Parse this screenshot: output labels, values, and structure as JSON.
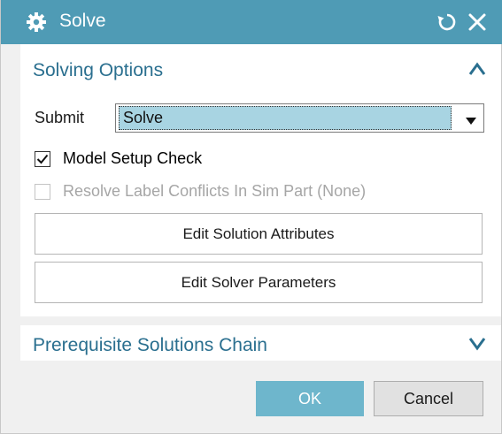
{
  "window": {
    "title": "Solve",
    "icons": {
      "app": "gear-icon",
      "reset": "reset-icon",
      "close": "close-icon"
    },
    "title_bar_color": "#4f9bb5"
  },
  "solving_options": {
    "title": "Solving Options",
    "expanded": true,
    "submit": {
      "label": "Submit",
      "selected": "Solve"
    },
    "model_setup_check": {
      "label": "Model Setup Check",
      "checked": true,
      "enabled": true
    },
    "resolve_label_conflicts": {
      "label": "Resolve Label Conflicts In Sim Part (None)",
      "checked": false,
      "enabled": false
    },
    "edit_solution_attributes_label": "Edit Solution Attributes",
    "edit_solver_parameters_label": "Edit Solver Parameters"
  },
  "prerequisite": {
    "title": "Prerequisite Solutions Chain",
    "expanded": false
  },
  "footer": {
    "ok_label": "OK",
    "cancel_label": "Cancel"
  },
  "colors": {
    "accent": "#4f9bb5",
    "section_title": "#2a6f8f",
    "selection": "#a8d4e2",
    "ok_button": "#6eb6cc"
  }
}
